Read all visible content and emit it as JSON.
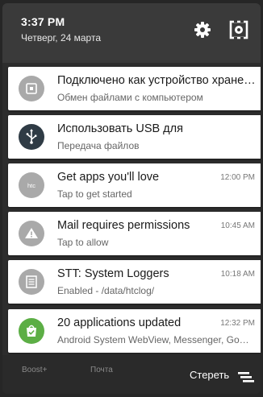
{
  "status": {
    "time": "3:37 PM",
    "date": "Четверг, 24 марта"
  },
  "notifications": [
    {
      "icon": "usb-storage-icon",
      "title": "Подключено как устройство хране…",
      "subtitle": "Обмен файлами с компьютером",
      "time": ""
    },
    {
      "icon": "usb-icon",
      "title": "Использовать USB для",
      "subtitle": "Передача файлов",
      "time": ""
    },
    {
      "icon": "htc-icon",
      "title": "Get apps you'll love",
      "subtitle": "Tap to get started",
      "time": "12:00 PM"
    },
    {
      "icon": "warning-icon",
      "title": "Mail requires permissions",
      "subtitle": "Tap to allow",
      "time": "10:45 AM"
    },
    {
      "icon": "system-log-icon",
      "title": "STT: System Loggers",
      "subtitle": "Enabled - /data/htclog/",
      "time": "10:18 AM"
    },
    {
      "icon": "app-update-icon",
      "title": "20 applications updated",
      "subtitle": "Android System WebView, Messenger, Go…",
      "time": "12:32 PM"
    }
  ],
  "bottom": {
    "left_label": "Boost+",
    "mid_label": "Почта",
    "clear_label": "Стереть"
  },
  "colors": {
    "grey_icon": "#a9a9a9",
    "usb_icon": "#2f3b45",
    "green_icon": "#5cae45"
  }
}
